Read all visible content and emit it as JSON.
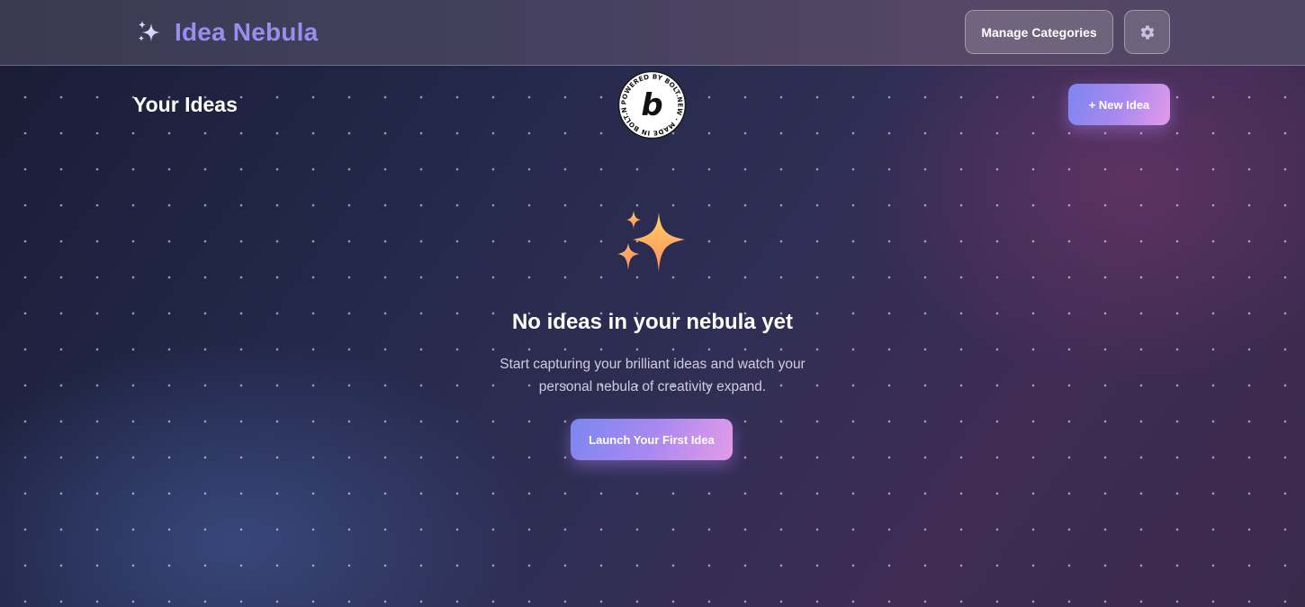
{
  "app": {
    "title": "Idea Nebula",
    "brand_icon": "sparkles-icon"
  },
  "header": {
    "manage_categories_label": "Manage Categories",
    "settings_icon": "gear-icon"
  },
  "main": {
    "section_title": "Your Ideas",
    "new_idea_label": "+ New Idea"
  },
  "badge": {
    "ring_text": "POWERED BY BOLT.NEW · MADE IN BOLT.NEW ·",
    "letter": "b"
  },
  "empty_state": {
    "icon": "sparkles-icon",
    "title": "No ideas in your nebula yet",
    "description": "Start capturing your brilliant ideas and watch your personal nebula of creativity expand.",
    "cta_label": "Launch Your First Idea"
  },
  "colors": {
    "brand_text": "#9b8cf0",
    "button_gradient_start": "#7d86f0",
    "button_gradient_end": "#e39be8",
    "sparkle_light": "#ffd466",
    "sparkle_dark": "#ff8a5c"
  }
}
